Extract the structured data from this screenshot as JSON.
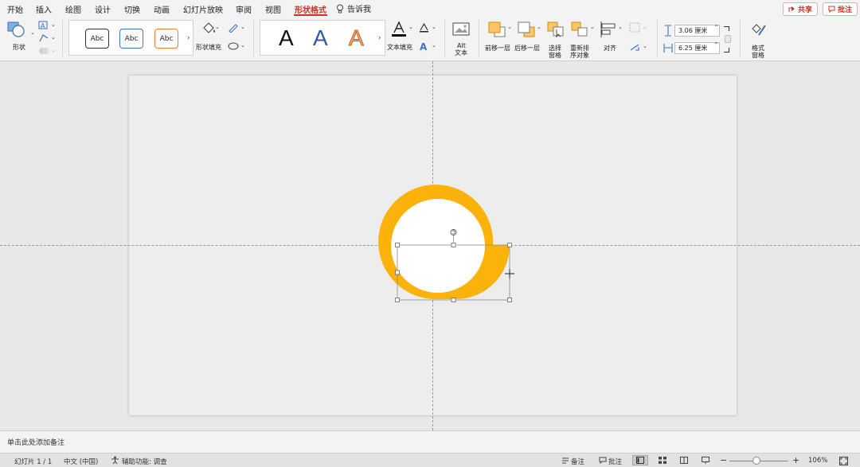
{
  "menu": {
    "items": [
      "开始",
      "插入",
      "绘图",
      "设计",
      "切换",
      "动画",
      "幻灯片放映",
      "审阅",
      "视图",
      "形状格式"
    ],
    "active": "形状格式",
    "tell_me": "告诉我",
    "share": "共享",
    "comments": "批注"
  },
  "ribbon": {
    "shapes_label": "形状",
    "style_thumbs": [
      "Abc",
      "Abc",
      "Abc"
    ],
    "shape_fill_label": "形状填充",
    "wordart": [
      "A",
      "A",
      "A"
    ],
    "text_fill_label": "文本填充",
    "alt_text_label_1": "Alt",
    "alt_text_label_2": "文本",
    "bring_forward_label": "前移一层",
    "send_backward_label": "后移一层",
    "selection_pane_label_1": "选择",
    "selection_pane_label_2": "窗格",
    "reorder_label_1": "重新排",
    "reorder_label_2": "序对象",
    "align_label": "对齐",
    "height_value": "3.06 厘米",
    "width_value": "6.25 厘米",
    "format_pane_label_1": "格式",
    "format_pane_label_2": "窗格",
    "icons": [
      "shape-icon",
      "edit-shape-icon",
      "text-box-icon",
      "paint-bucket-icon",
      "pen-icon",
      "eraser-icon",
      "text-color-icon",
      "text-outline-icon",
      "text-effects-icon",
      "alt-text-icon",
      "bring-forward-icon",
      "send-backward-icon",
      "selection-pane-icon",
      "reorder-icon",
      "align-icon",
      "rotate-icon",
      "group-icon",
      "height-icon",
      "width-icon",
      "format-pane-icon"
    ]
  },
  "notes": {
    "placeholder": "单击此处添加备注"
  },
  "status": {
    "slide_info": "幻灯片 1 / 1",
    "language": "中文 (中国)",
    "accessibility": "辅助功能: 调查",
    "notes_btn": "备注",
    "comments_btn": "批注",
    "zoom": "106%",
    "zoom_level_fraction": 0.46
  },
  "colors": {
    "accent": "#c4362b",
    "ring": "#fbb20b",
    "white_disc": "#ffffff"
  }
}
